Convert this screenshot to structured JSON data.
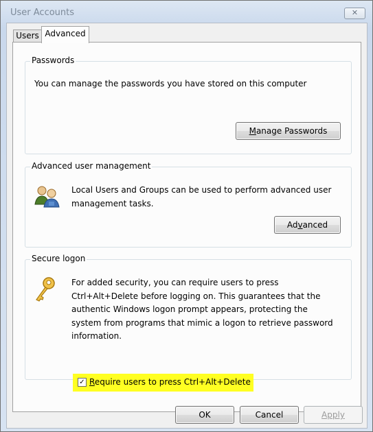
{
  "window": {
    "title": "User Accounts",
    "close_glyph": "✕"
  },
  "tabs": {
    "users": "Users",
    "advanced": "Advanced"
  },
  "passwords": {
    "group_label": "Passwords",
    "description": "You can manage the passwords you have stored on this computer",
    "button_mnemonic": "M",
    "button_rest": "anage Passwords"
  },
  "advanced_mgmt": {
    "group_label": "Advanced user management",
    "description_line1": "Local Users and Groups can be used to perform advanced user",
    "description_line2": "management tasks.",
    "button_pre": "Ad",
    "button_mnemonic": "v",
    "button_post": "anced",
    "icon": "users-group-icon"
  },
  "secure_logon": {
    "group_label": "Secure logon",
    "lines": [
      "For added security, you can require users to press",
      "Ctrl+Alt+Delete before logging on. This guarantees that the",
      "authentic Windows logon prompt appears, protecting the",
      "system from programs that mimic a logon to retrieve password",
      "information."
    ],
    "checkbox_checked": true,
    "checkbox_mnemonic": "R",
    "checkbox_rest": "equire users to press Ctrl+Alt+Delete",
    "icon": "key-icon",
    "highlight_color": "#ffff22"
  },
  "footer": {
    "ok": "OK",
    "cancel": "Cancel",
    "apply": "Apply"
  }
}
